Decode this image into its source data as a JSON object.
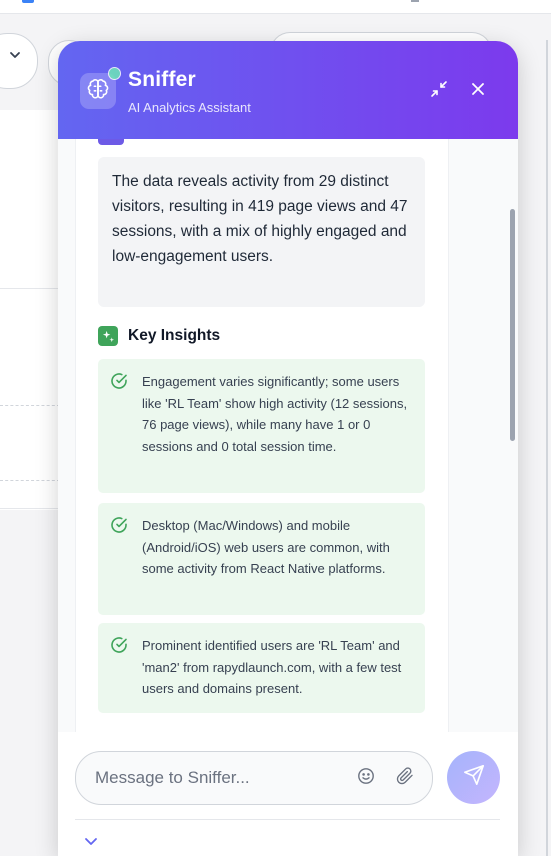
{
  "header": {
    "title": "Sniffer",
    "subtitle": "AI Analytics Assistant",
    "online": true
  },
  "message": {
    "summary": "The data reveals activity from 29 distinct visitors, resulting in 419 page views and 47 sessions, with a mix of highly engaged and low-engagement users.",
    "insights_heading": "Key Insights",
    "insights": [
      "Engagement varies significantly; some users like 'RL Team' show high activity (12 sessions, 76 page views), while many have 1 or 0 sessions and 0 total session time.",
      "Desktop (Mac/Windows) and mobile (Android/iOS) web users are common, with some activity from React Native platforms.",
      "Prominent identified users are 'RL Team' and 'man2' from rapydlaunch.com, with a few test users and domains present."
    ]
  },
  "composer": {
    "placeholder": "Message to Sniffer..."
  },
  "icons": {
    "avatar": "brain-icon",
    "minimize": "minimize-icon",
    "close": "close-icon",
    "insights": "sparkle-icon",
    "check": "check-circle-icon",
    "emoji": "smiley-icon",
    "attach": "paperclip-icon",
    "send": "send-icon",
    "collapse": "chevron-down-icon"
  },
  "colors": {
    "header_start": "#6366f1",
    "header_end": "#7c3aed",
    "insight_bg": "#ecf8ee",
    "insight_check": "#3fa45a",
    "send_button": "#a5b4fc"
  }
}
